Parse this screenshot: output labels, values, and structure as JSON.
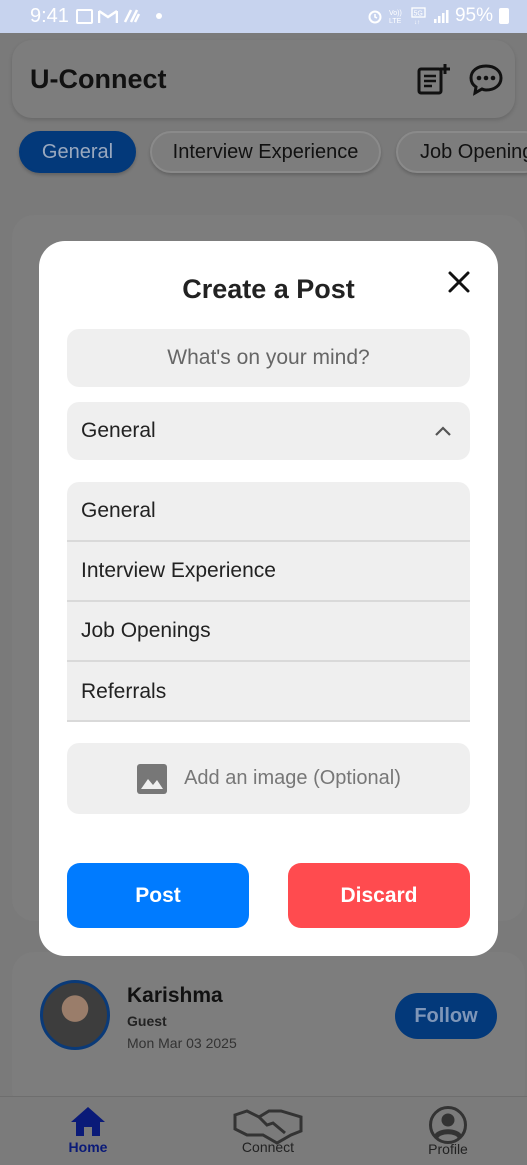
{
  "status_bar": {
    "time": "9:41",
    "battery": "95%"
  },
  "app": {
    "title": "U-Connect",
    "icons": [
      "new-post-icon",
      "chat-icon"
    ],
    "chips": [
      "General",
      "Interview Experience",
      "Job Opening"
    ],
    "active_chip": "General"
  },
  "post_card": {
    "name": "Karishma",
    "role": "Guest",
    "date": "Mon Mar 03 2025",
    "follow_label": "Follow"
  },
  "bottom_nav": {
    "items": [
      {
        "label": "Home",
        "icon": "home-icon",
        "active": true
      },
      {
        "label": "Connect",
        "icon": "handshake-icon",
        "active": false
      },
      {
        "label": "Profile",
        "icon": "profile-icon",
        "active": false
      }
    ]
  },
  "modal": {
    "title": "Create a Post",
    "input_placeholder": "What's on your mind?",
    "selected_category": "General",
    "options": [
      "General",
      "Interview Experience",
      "Job Openings",
      "Referrals"
    ],
    "image_label": "Add an image (Optional)",
    "post_label": "Post",
    "discard_label": "Discard"
  },
  "colors": {
    "primary": "#007bff",
    "danger": "#ff4b4f",
    "nav_active": "#0a1a78",
    "active_chip": "#03397a"
  }
}
